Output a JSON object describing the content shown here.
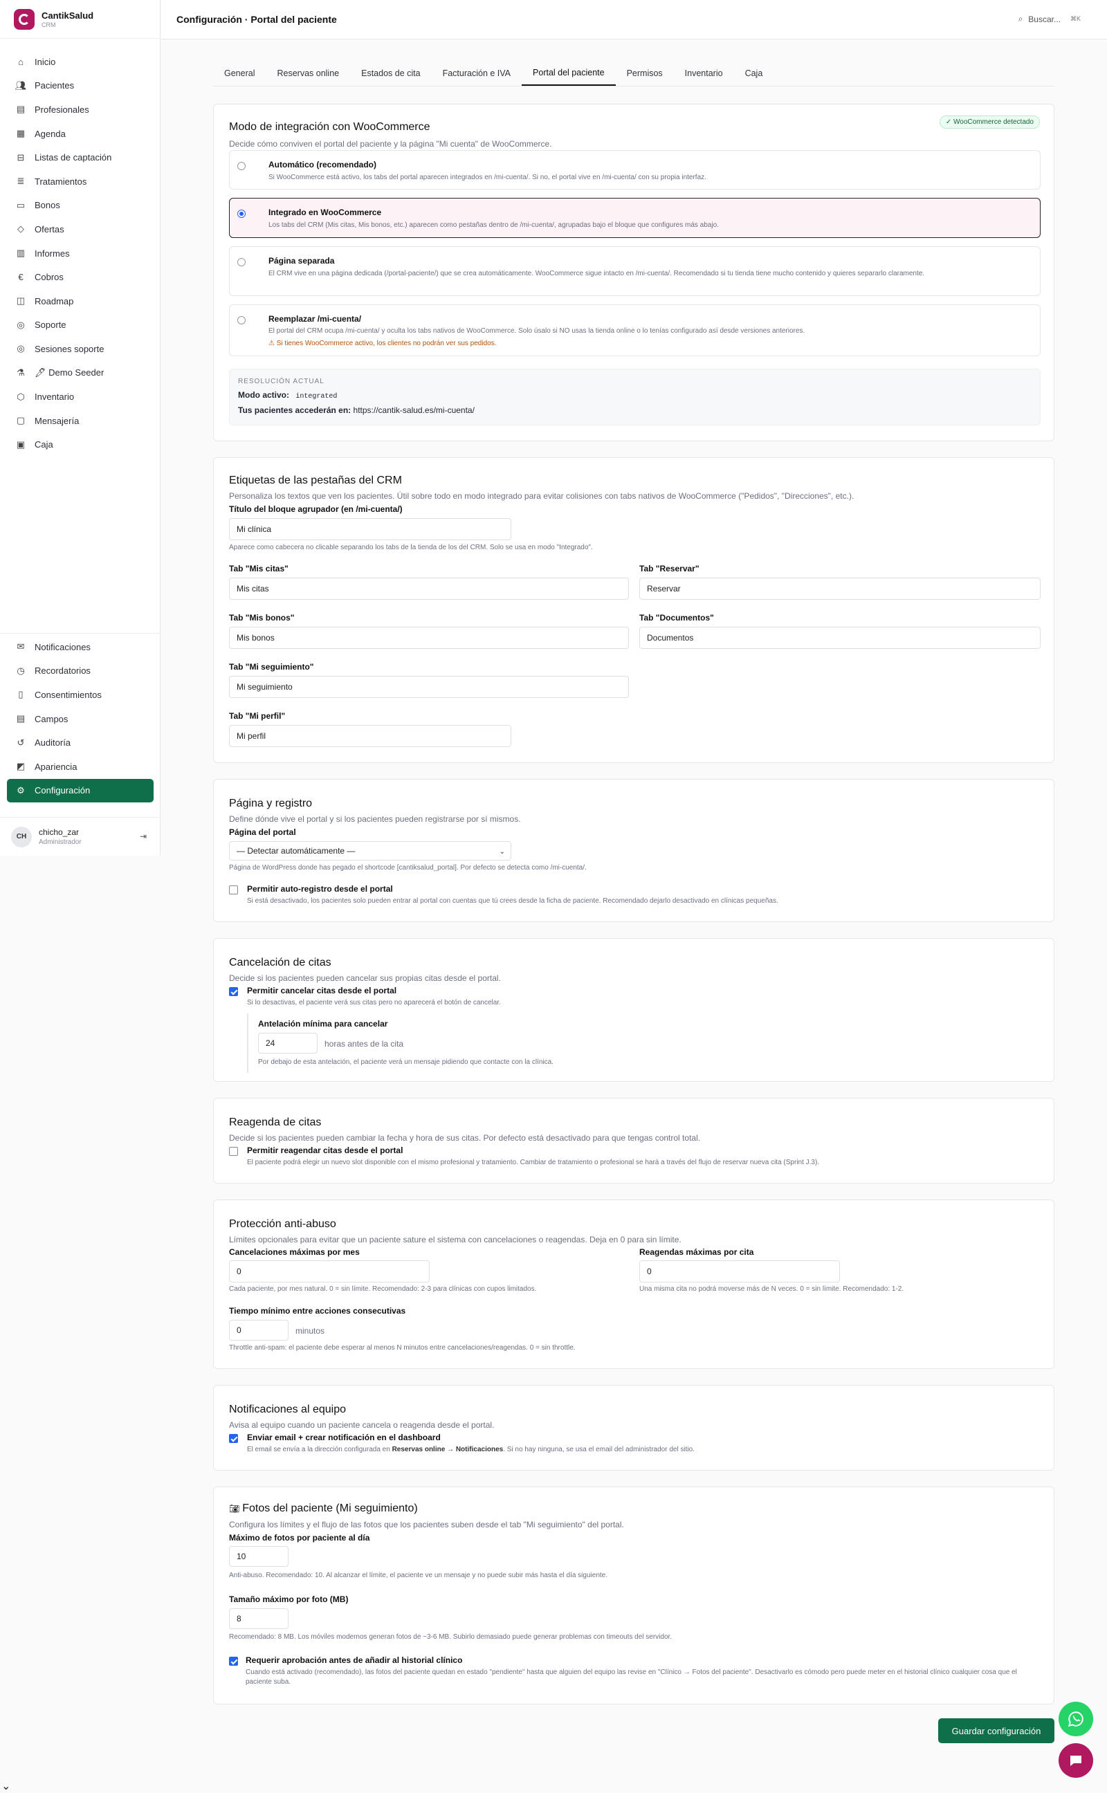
{
  "brand": {
    "name": "CantikSalud",
    "sub": "CRM"
  },
  "nav": [
    "Inicio",
    "Pacientes",
    "Profesionales",
    "Agenda",
    "Listas de captación",
    "Tratamientos",
    "Bonos",
    "Ofertas",
    "Informes",
    "Cobros",
    "Roadmap",
    "Soporte",
    "Sesiones soporte",
    "🖊 Demo Seeder",
    "Inventario",
    "Mensajería",
    "Caja"
  ],
  "nav_bottom": [
    "Notificaciones",
    "Recordatorios",
    "Consentimientos",
    "Campos",
    "Auditoría",
    "Apariencia",
    "Configuración"
  ],
  "user": {
    "initials": "CH",
    "name": "chicho_zar",
    "role": "Administrador"
  },
  "topbar": {
    "title": "Configuración · Portal del paciente",
    "search": "Buscar...",
    "shortcut": "⌘K"
  },
  "tabs": [
    "General",
    "Reservas online",
    "Estados de cita",
    "Facturación e IVA",
    "Portal del paciente",
    "Permisos",
    "Inventario",
    "Caja"
  ],
  "woo": {
    "title": "Modo de integración con WooCommerce",
    "desc": "Decide cómo conviven el portal del paciente y la página \"Mi cuenta\" de WooCommerce.",
    "badge": "✓ WooCommerce detectado",
    "options": [
      {
        "title": "Automático (recomendado)",
        "desc": "Si WooCommerce está activo, los tabs del portal aparecen integrados en /mi-cuenta/. Si no, el portal vive en /mi-cuenta/ con su propia interfaz."
      },
      {
        "title": "Integrado en WooCommerce",
        "desc": "Los tabs del CRM (Mis citas, Mis bonos, etc.) aparecen como pestañas dentro de /mi-cuenta/, agrupadas bajo el bloque que configures más abajo."
      },
      {
        "title": "Página separada",
        "desc": "El CRM vive en una página dedicada (/portal-paciente/) que se crea automáticamente. WooCommerce sigue intacto en /mi-cuenta/. Recomendado si tu tienda tiene mucho contenido y quieres separarlo claramente."
      },
      {
        "title": "Reemplazar /mi-cuenta/",
        "desc": "El portal del CRM ocupa /mi-cuenta/ y oculta los tabs nativos de WooCommerce. Solo úsalo si NO usas la tienda online o lo tenías configurado así desde versiones anteriores.",
        "warn": "⚠ Si tienes WooCommerce activo, los clientes no podrán ver sus pedidos."
      }
    ],
    "res_label": "RESOLUCIÓN ACTUAL",
    "res_mode_label": "Modo activo:",
    "res_mode": "integrated",
    "res_url_label": "Tus pacientes accederán en:",
    "res_url": "https://cantik-salud.es/mi-cuenta/"
  },
  "labels": {
    "title": "Etiquetas de las pestañas del CRM",
    "desc": "Personaliza los textos que ven los pacientes. Útil sobre todo en modo integrado para evitar colisiones con tabs nativos de WooCommerce (\"Pedidos\", \"Direcciones\", etc.).",
    "group_label": "Título del bloque agrupador (en /mi-cuenta/)",
    "group_value": "Mi clínica",
    "group_help": "Aparece como cabecera no clicable separando los tabs de la tienda de los del CRM. Solo se usa en modo \"Integrado\".",
    "citas_label": "Tab \"Mis citas\"",
    "citas": "Mis citas",
    "reservar_label": "Tab \"Reservar\"",
    "reservar": "Reservar",
    "bonos_label": "Tab \"Mis bonos\"",
    "bonos": "Mis bonos",
    "docs_label": "Tab \"Documentos\"",
    "docs": "Documentos",
    "seg_label": "Tab \"Mi seguimiento\"",
    "seg": "Mi seguimiento",
    "perfil_label": "Tab \"Mi perfil\"",
    "perfil": "Mi perfil"
  },
  "page": {
    "title": "Página y registro",
    "desc": "Define dónde vive el portal y si los pacientes pueden registrarse por sí mismos.",
    "portal_label": "Página del portal",
    "portal_value": "— Detectar automáticamente —",
    "portal_help": "Página de WordPress donde has pegado el shortcode [cantiksalud_portal]. Por defecto se detecta como /mi-cuenta/.",
    "reg_label": "Permitir auto-registro desde el portal",
    "reg_help": "Si está desactivado, los pacientes solo pueden entrar al portal con cuentas que tú crees desde la ficha de paciente. Recomendado dejarlo desactivado en clínicas pequeñas."
  },
  "cancel": {
    "title": "Cancelación de citas",
    "desc": "Decide si los pacientes pueden cancelar sus propias citas desde el portal.",
    "chk_label": "Permitir cancelar citas desde el portal",
    "chk_help": "Si lo desactivas, el paciente verá sus citas pero no aparecerá el botón de cancelar.",
    "min_label": "Antelación mínima para cancelar",
    "min_value": "24",
    "min_unit": "horas antes de la cita",
    "min_help": "Por debajo de esta antelación, el paciente verá un mensaje pidiendo que contacte con la clínica."
  },
  "resched": {
    "title": "Reagenda de citas",
    "desc": "Decide si los pacientes pueden cambiar la fecha y hora de sus citas. Por defecto está desactivado para que tengas control total.",
    "chk_label": "Permitir reagendar citas desde el portal",
    "chk_help": "El paciente podrá elegir un nuevo slot disponible con el mismo profesional y tratamiento. Cambiar de tratamiento o profesional se hará a través del flujo de reservar nueva cita (Sprint J.3)."
  },
  "abuse": {
    "title": "Protección anti-abuso",
    "desc": "Límites opcionales para evitar que un paciente sature el sistema con cancelaciones o reagendas. Deja en 0 para sin límite.",
    "cmax_label": "Cancelaciones máximas por mes",
    "cmax": "0",
    "cmax_help": "Cada paciente, por mes natural. 0 = sin límite. Recomendado: 2-3 para clínicas con cupos limitados.",
    "rmax_label": "Reagendas máximas por cita",
    "rmax": "0",
    "rmax_help": "Una misma cita no podrá moverse más de N veces. 0 = sin límite. Recomendado: 1-2.",
    "tmin_label": "Tiempo mínimo entre acciones consecutivas",
    "tmin": "0",
    "tmin_unit": "minutos",
    "tmin_help": "Throttle anti-spam: el paciente debe esperar al menos N minutos entre cancelaciones/reagendas. 0 = sin throttle."
  },
  "notif": {
    "title": "Notificaciones al equipo",
    "desc": "Avisa al equipo cuando un paciente cancela o reagenda desde el portal.",
    "chk_label": "Enviar email + crear notificación en el dashboard",
    "help_a": "El email se envía a la dirección configurada en ",
    "help_b": "Reservas online → Notificaciones",
    "help_c": ". Si no hay ninguna, se usa el email del administrador del sitio."
  },
  "photos": {
    "title": "Fotos del paciente (Mi seguimiento)",
    "desc": "Configura los límites y el flujo de las fotos que los pacientes suben desde el tab \"Mi seguimiento\" del portal.",
    "max_label": "Máximo de fotos por paciente al día",
    "max": "10",
    "max_help": "Anti-abuso. Recomendado: 10. Al alcanzar el límite, el paciente ve un mensaje y no puede subir más hasta el día siguiente.",
    "size_label": "Tamaño máximo por foto (MB)",
    "size": "8",
    "size_help": "Recomendado: 8 MB. Los móviles modernos generan fotos de ~3-6 MB. Subirlo demasiado puede generar problemas con timeouts del servidor.",
    "chk_label": "Requerir aprobación antes de añadir al historial clínico",
    "chk_help": "Cuando está activado (recomendado), las fotos del paciente quedan en estado \"pendiente\" hasta que alguien del equipo las revise en \"Clínico → Fotos del paciente\". Desactivarlo es cómodo pero puede meter en el historial clínico cualquier cosa que el paciente suba."
  },
  "save": "Guardar configuración"
}
